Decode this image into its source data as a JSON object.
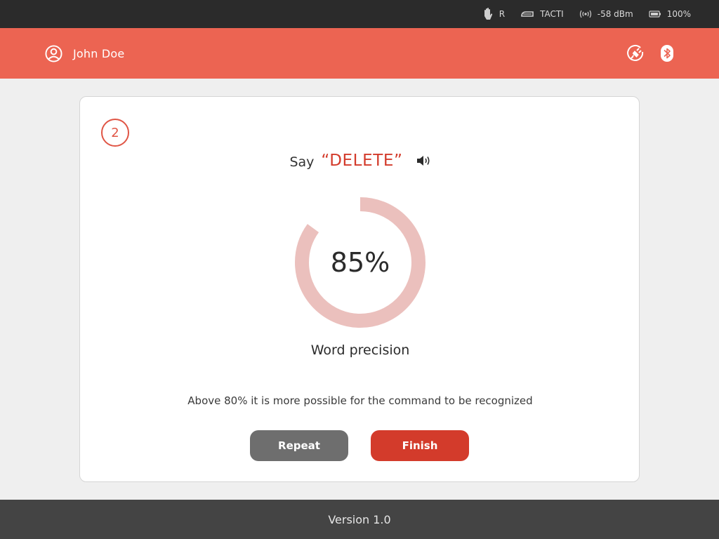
{
  "status_bar": {
    "hand_side": "R",
    "device": "TACTI",
    "signal": "-58 dBm",
    "battery": "100%"
  },
  "header": {
    "user_name": "John Doe",
    "icons": [
      "user-circle-icon",
      "plug-icon",
      "bluetooth-icon"
    ],
    "background_color": "#ec6452"
  },
  "card": {
    "step_number": "2",
    "say_label": "Say",
    "command": "“DELETE”",
    "precision_value": "85%",
    "precision_fraction": 0.85,
    "precision_label": "Word precision",
    "hint": "Above 80% it is more possible for the command to be recognized",
    "accent_color": "#d33b2b",
    "gauge_color": "#ebc0bd"
  },
  "actions": {
    "repeat_label": "Repeat",
    "finish_label": "Finish"
  },
  "footer": {
    "version": "Version 1.0"
  }
}
